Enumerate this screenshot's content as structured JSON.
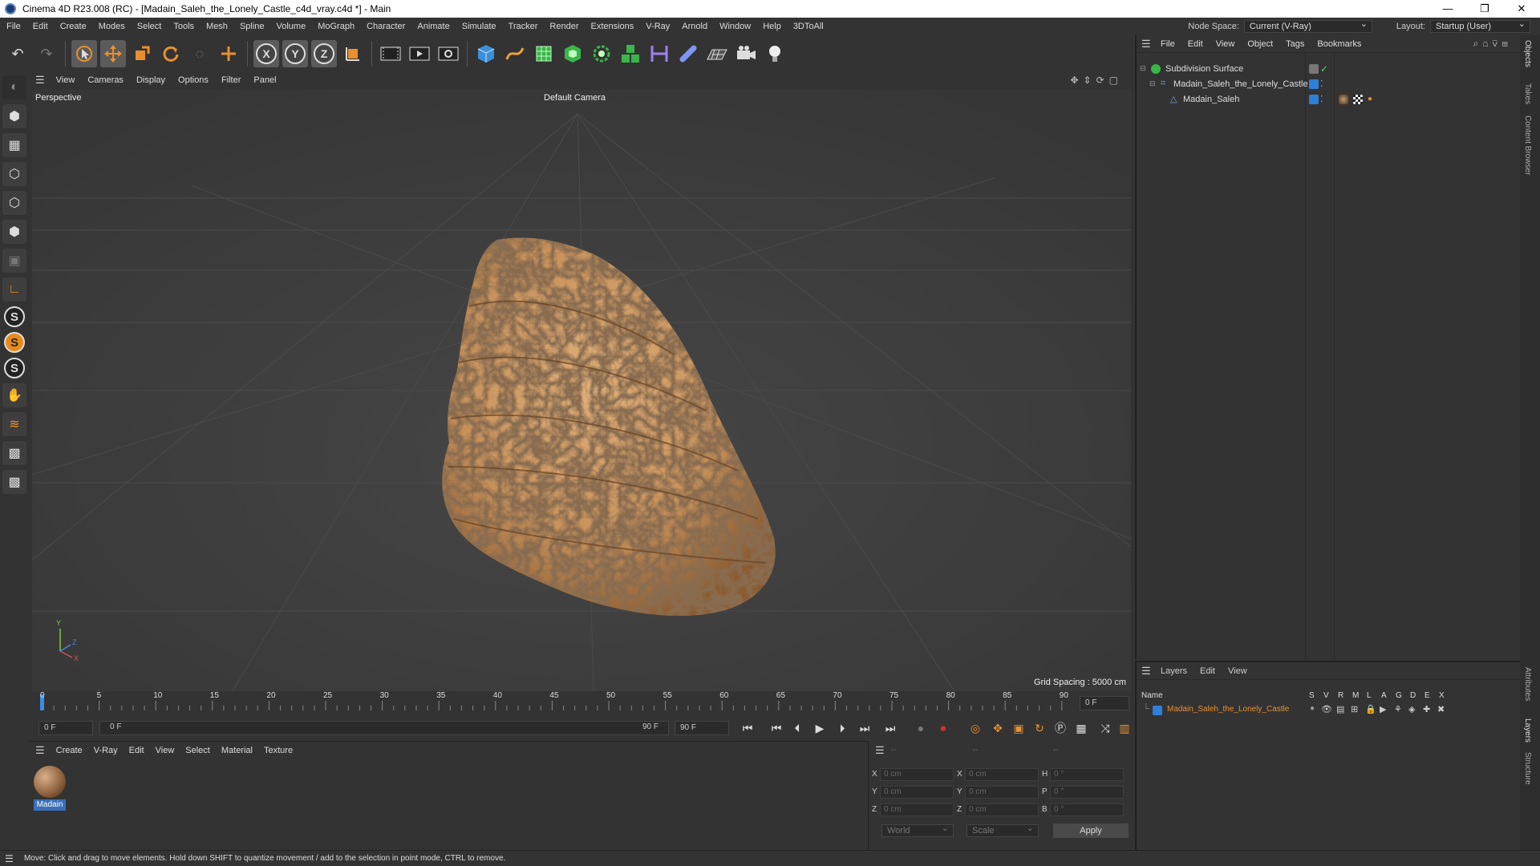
{
  "window": {
    "title": "Cinema 4D R23.008 (RC) - [Madain_Saleh_the_Lonely_Castle_c4d_vray.c4d *] - Main"
  },
  "menu": [
    "File",
    "Edit",
    "Create",
    "Modes",
    "Select",
    "Tools",
    "Mesh",
    "Spline",
    "Volume",
    "MoGraph",
    "Character",
    "Animate",
    "Simulate",
    "Tracker",
    "Render",
    "Extensions",
    "V-Ray",
    "Arnold",
    "Window",
    "Help",
    "3DToAll"
  ],
  "node_space": {
    "label": "Node Space:",
    "value": "Current (V-Ray)"
  },
  "layout": {
    "label": "Layout:",
    "value": "Startup (User)"
  },
  "viewport": {
    "menu": [
      "View",
      "Cameras",
      "Display",
      "Options",
      "Filter",
      "Panel"
    ],
    "view_name": "Perspective",
    "camera": "Default Camera",
    "grid_spacing": "Grid Spacing : 5000 cm"
  },
  "timeline": {
    "ticks": [
      "0",
      "5",
      "10",
      "15",
      "20",
      "25",
      "30",
      "35",
      "40",
      "45",
      "50",
      "55",
      "60",
      "65",
      "70",
      "75",
      "80",
      "85",
      "90"
    ],
    "current_frame": "0 F",
    "start_field": "0 F",
    "range_start": "0 F",
    "range_end": "90 F",
    "end_field": "90 F"
  },
  "material_manager": {
    "menu": [
      "Create",
      "V-Ray",
      "Edit",
      "View",
      "Select",
      "Material",
      "Texture"
    ],
    "materials": [
      {
        "name": "Madain"
      }
    ]
  },
  "coordinates": {
    "header": [
      "--",
      "--",
      "--"
    ],
    "rows": [
      {
        "axis": "X",
        "pos": "0 cm",
        "axis2": "X",
        "size": "0 cm",
        "axis3": "H",
        "rot": "0 °"
      },
      {
        "axis": "Y",
        "pos": "0 cm",
        "axis2": "Y",
        "size": "0 cm",
        "axis3": "P",
        "rot": "0 °"
      },
      {
        "axis": "Z",
        "pos": "0 cm",
        "axis2": "Z",
        "size": "0 cm",
        "axis3": "B",
        "rot": "0 °"
      }
    ],
    "mode": "World",
    "size_mode": "Scale",
    "apply": "Apply"
  },
  "status": "Move: Click and drag to move elements. Hold down SHIFT to quantize movement / add to the selection in point mode, CTRL to remove.",
  "object_manager": {
    "menu": [
      "File",
      "Edit",
      "View",
      "Object",
      "Tags",
      "Bookmarks"
    ],
    "objects": [
      {
        "name": "Subdivision Surface"
      },
      {
        "name": "Madain_Saleh_the_Lonely_Castle"
      },
      {
        "name": "Madain_Saleh"
      }
    ]
  },
  "layer_manager": {
    "menu": [
      "Layers",
      "Edit",
      "View"
    ],
    "columns": [
      "Name",
      "S",
      "V",
      "R",
      "M",
      "L",
      "A",
      "G",
      "D",
      "E",
      "X"
    ],
    "layers": [
      {
        "name": "Madain_Saleh_the_Lonely_Castle",
        "color": "#2f7fd8"
      }
    ]
  },
  "side_tabs": [
    "Objects",
    "Takes",
    "Content Browser",
    "Attributes",
    "Layers",
    "Structure"
  ],
  "colors": {
    "accent": "#2f7fd8",
    "layer_name": "#e8902e",
    "record": "#d23030",
    "rock": "#c9925a"
  }
}
